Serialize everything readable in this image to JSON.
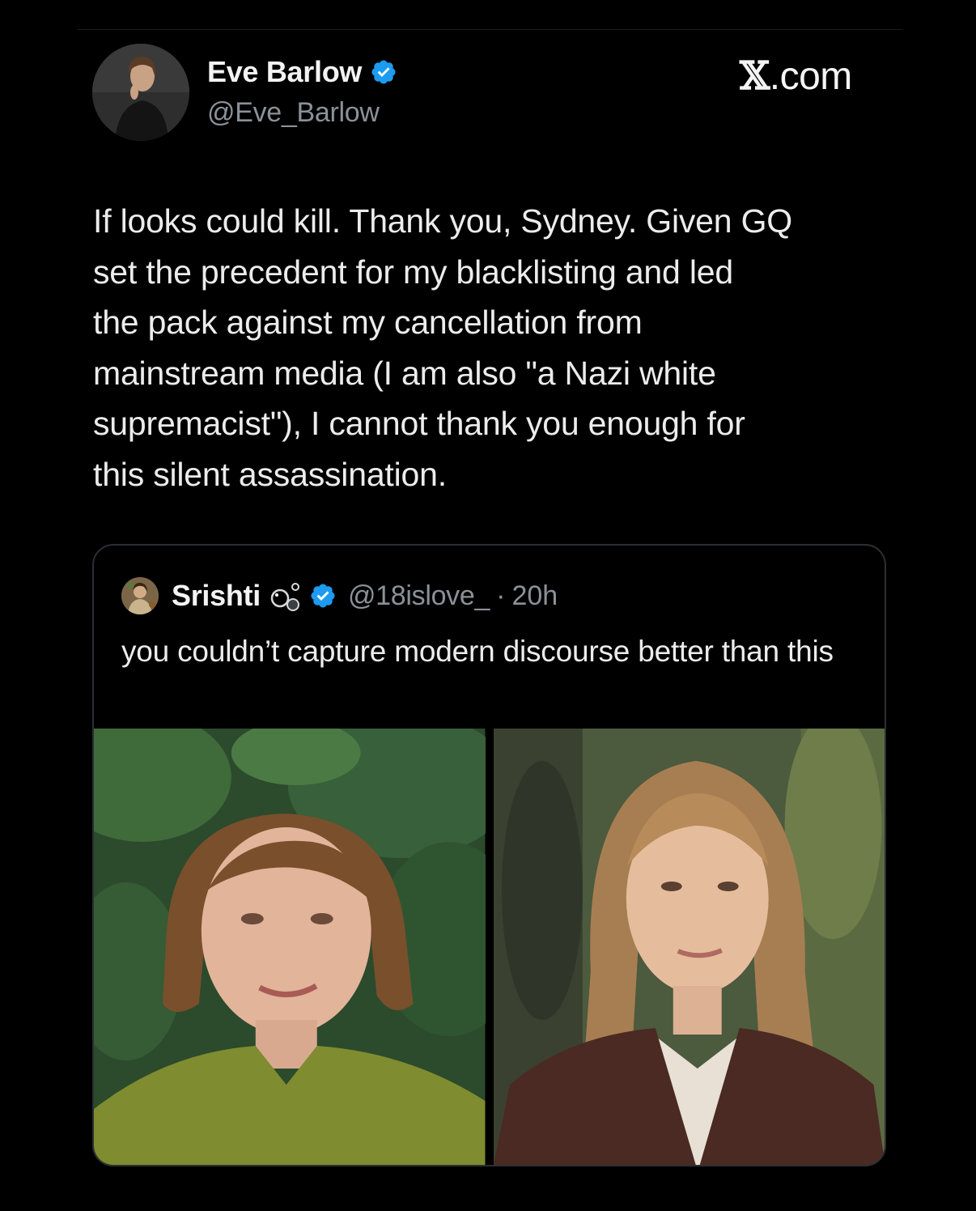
{
  "author": {
    "display_name": "Eve Barlow",
    "handle": "@Eve_Barlow",
    "verified": true,
    "avatar": "profile-photo"
  },
  "brand": {
    "logo_glyph": "𝕏",
    "domain_suffix": ".com"
  },
  "tweet": {
    "text": "If looks could kill. Thank you, Sydney. Given GQ\nset the precedent for my blacklisting and led\nthe pack against my cancellation from\nmainstream media (I am also \"a Nazi white\nsupremacist\"), I cannot thank you enough for\nthis silent assassination."
  },
  "quoted_tweet": {
    "display_name": "Srishti",
    "emoji_icon": "bubbles-icon",
    "verified": true,
    "handle": "@18islove_",
    "separator": "·",
    "time": "20h",
    "text": "you couldn’t capture modern discourse better than this",
    "media": [
      {
        "icon": "woman-in-green-sweater-photo"
      },
      {
        "icon": "woman-in-leather-jacket-photo"
      }
    ]
  },
  "colors": {
    "background": "#000000",
    "text_primary": "#e7e9ea",
    "text_secondary": "#8b9198",
    "verified_blue": "#1d9bf0",
    "card_border": "#2b2f33"
  }
}
